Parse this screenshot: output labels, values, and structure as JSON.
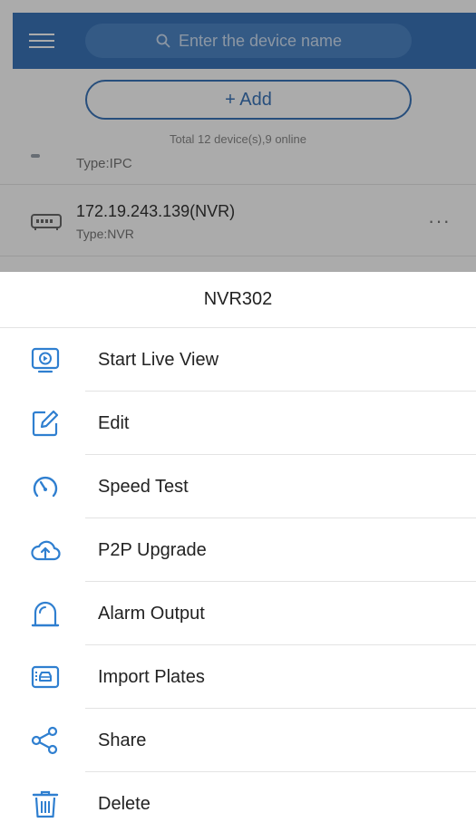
{
  "background": {
    "search": {
      "placeholder": "Enter the device name",
      "icon": "search-icon"
    },
    "menu_icon": "menu-icon",
    "add_label": "+ Add",
    "summary": "Total 12 device(s),9 online",
    "partial_row": {
      "type": "Type:IPC"
    },
    "device": {
      "name": "172.19.243.139(NVR)",
      "type": "Type:NVR",
      "icon": "nvr-device-icon",
      "more": "···"
    },
    "accent_color": "#3b75b9"
  },
  "sheet": {
    "title": "NVR302",
    "items": [
      {
        "label": "Start Live View",
        "icon": "live-view-icon"
      },
      {
        "label": "Edit",
        "icon": "edit-icon"
      },
      {
        "label": "Speed Test",
        "icon": "speedometer-icon"
      },
      {
        "label": "P2P Upgrade",
        "icon": "cloud-upload-icon"
      },
      {
        "label": "Alarm Output",
        "icon": "alarm-light-icon"
      },
      {
        "label": "Import Plates",
        "icon": "car-plate-icon"
      },
      {
        "label": "Share",
        "icon": "share-icon"
      },
      {
        "label": "Delete",
        "icon": "trash-icon"
      }
    ]
  }
}
